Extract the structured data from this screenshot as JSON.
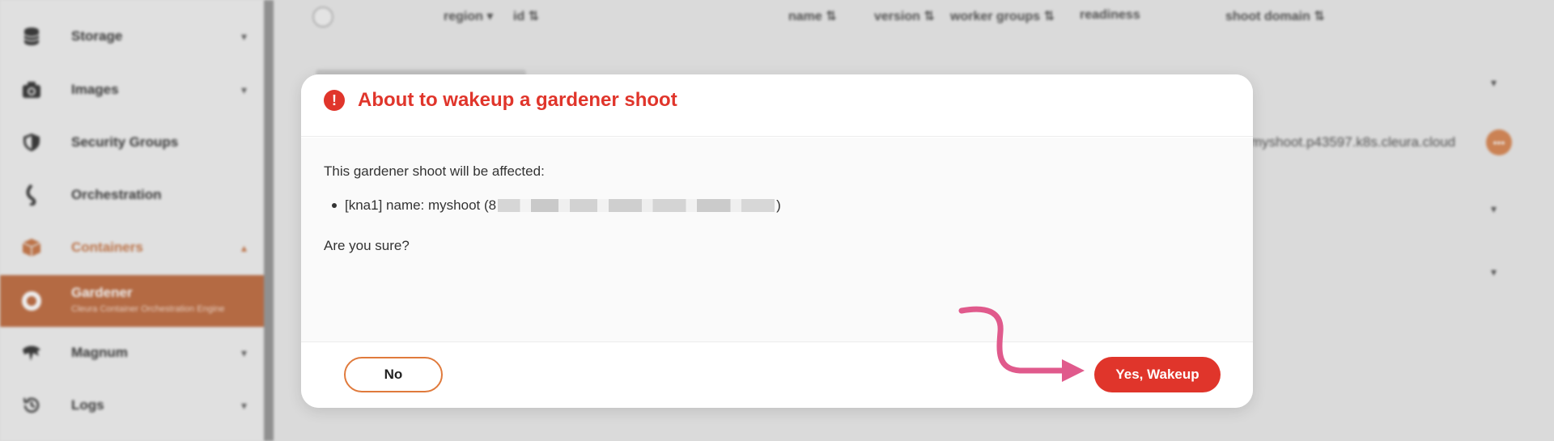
{
  "sidebar": {
    "items": [
      {
        "label": "Storage",
        "icon": "database-icon"
      },
      {
        "label": "Images",
        "icon": "camera-icon"
      },
      {
        "label": "Security Groups",
        "icon": "shield-icon"
      },
      {
        "label": "Orchestration",
        "icon": "orchestration-icon"
      },
      {
        "label": "Containers",
        "icon": "container-box-icon"
      },
      {
        "label": "Gardener",
        "sublabel": "Cleura Container Orchestration Engine",
        "icon": "gardener-icon"
      },
      {
        "label": "Magnum",
        "icon": "magnum-icon"
      },
      {
        "label": "Logs",
        "icon": "history-icon"
      }
    ]
  },
  "table": {
    "headers": [
      "region",
      "id",
      "name",
      "version",
      "worker groups",
      "readiness",
      "shoot domain"
    ],
    "row_domain": "myshoot.p43597.k8s.cleura.cloud"
  },
  "modal": {
    "title": "About to wakeup a gardener shoot",
    "affected_text": "This gardener shoot will be affected:",
    "item_prefix": "[kna1] name: myshoot (8",
    "item_suffix": ")",
    "confirm_text": "Are you sure?",
    "no_label": "No",
    "yes_label": "Yes, Wakeup"
  },
  "colors": {
    "danger": "#e0352b",
    "accent": "#e07a3c",
    "sidebar_active": "#c07046",
    "annotation_arrow": "#e05a8c"
  }
}
